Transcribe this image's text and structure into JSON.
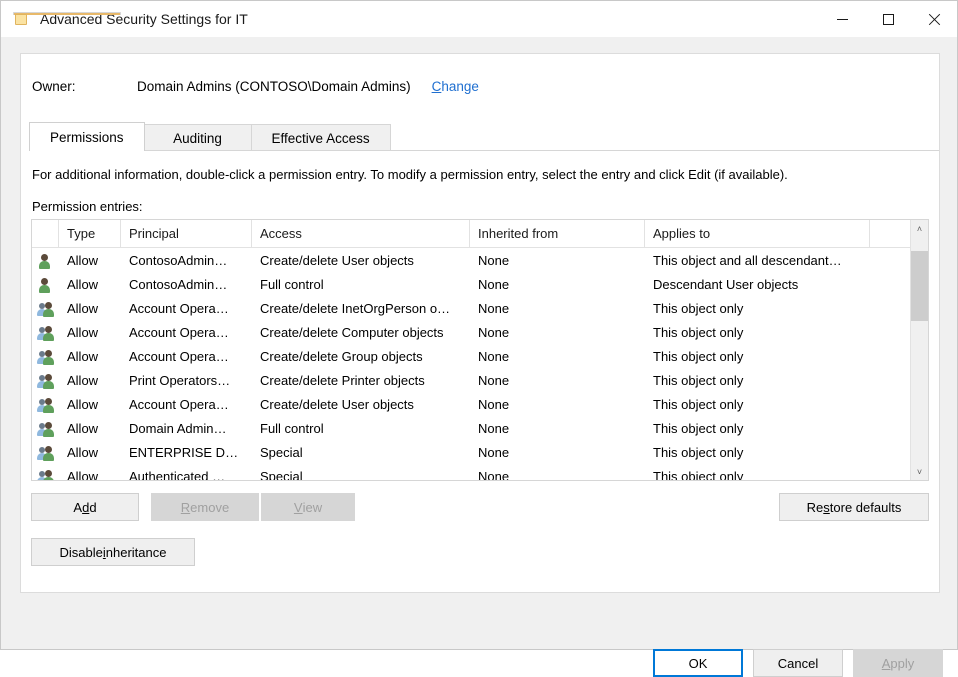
{
  "window": {
    "title": "Advanced Security Settings for IT",
    "icon": "folder-icon",
    "caption_buttons": {
      "minimize": "minimize-icon",
      "maximize": "maximize-icon",
      "close": "close-icon"
    }
  },
  "owner": {
    "label": "Owner:",
    "value": "Domain Admins (CONTOSO\\Domain Admins)",
    "change_accel": "C",
    "change_rest": "hange"
  },
  "tabs": [
    {
      "label": "Permissions",
      "selected": true
    },
    {
      "label": "Auditing",
      "selected": false
    },
    {
      "label": "Effective Access",
      "selected": false
    }
  ],
  "info_text": "For additional information, double-click a permission entry. To modify a permission entry, select the entry and click Edit (if available).",
  "entries_label": "Permission entries:",
  "list": {
    "columns": [
      "Type",
      "Principal",
      "Access",
      "Inherited from",
      "Applies to"
    ],
    "rows": [
      {
        "icon": "user-icon",
        "type": "Allow",
        "principal": "ContosoAdmin…",
        "access": "Create/delete User objects",
        "inherited": "None",
        "applies": "This object and all descendant…"
      },
      {
        "icon": "user-icon",
        "type": "Allow",
        "principal": "ContosoAdmin…",
        "access": "Full control",
        "inherited": "None",
        "applies": "Descendant User objects"
      },
      {
        "icon": "group-icon",
        "type": "Allow",
        "principal": "Account Opera…",
        "access": "Create/delete InetOrgPerson o…",
        "inherited": "None",
        "applies": "This object only"
      },
      {
        "icon": "group-icon",
        "type": "Allow",
        "principal": "Account Opera…",
        "access": "Create/delete Computer objects",
        "inherited": "None",
        "applies": "This object only"
      },
      {
        "icon": "group-icon",
        "type": "Allow",
        "principal": "Account Opera…",
        "access": "Create/delete Group objects",
        "inherited": "None",
        "applies": "This object only"
      },
      {
        "icon": "group-icon",
        "type": "Allow",
        "principal": "Print Operators…",
        "access": "Create/delete Printer objects",
        "inherited": "None",
        "applies": "This object only"
      },
      {
        "icon": "group-icon",
        "type": "Allow",
        "principal": "Account Opera…",
        "access": "Create/delete User objects",
        "inherited": "None",
        "applies": "This object only"
      },
      {
        "icon": "group-icon",
        "type": "Allow",
        "principal": "Domain Admin…",
        "access": "Full control",
        "inherited": "None",
        "applies": "This object only"
      },
      {
        "icon": "group-icon",
        "type": "Allow",
        "principal": "ENTERPRISE D…",
        "access": "Special",
        "inherited": "None",
        "applies": "This object only"
      },
      {
        "icon": "group-icon",
        "type": "Allow",
        "principal": "Authenticated …",
        "access": "Special",
        "inherited": "None",
        "applies": "This object only"
      }
    ]
  },
  "buttons": {
    "add": {
      "pre": "A",
      "accel": "d",
      "post": "d",
      "disabled": false
    },
    "remove": {
      "pre": "",
      "accel": "R",
      "post": "emove",
      "disabled": true
    },
    "view": {
      "pre": "",
      "accel": "V",
      "post": "iew",
      "disabled": true
    },
    "restore": {
      "pre": "Re",
      "accel": "s",
      "post": "tore defaults",
      "disabled": false
    },
    "disable": {
      "pre": "Disable ",
      "accel": "i",
      "post": "nheritance",
      "disabled": false
    }
  },
  "footer": {
    "ok": {
      "pre": "",
      "accel": "",
      "post": "OK",
      "disabled": false
    },
    "cancel": {
      "pre": "",
      "accel": "",
      "post": "Cancel",
      "disabled": false
    },
    "apply": {
      "pre": "",
      "accel": "A",
      "post": "pply",
      "disabled": true
    }
  },
  "scrollbar": {
    "up_arrow": "˄",
    "down_arrow": "˅"
  },
  "colors": {
    "link": "#1f6fd0",
    "accent": "#0078d7",
    "dialog_bg": "#f0f0f0",
    "panel_bg": "#ffffff"
  }
}
